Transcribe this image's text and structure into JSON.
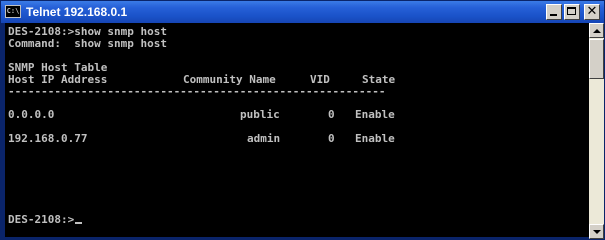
{
  "window": {
    "title": "Telnet 192.168.0.1",
    "icon": "console-icon",
    "icon_text": "C:\\",
    "controls": {
      "minimize": "minimize-icon",
      "maximize": "maximize-icon",
      "close": "close-icon",
      "close_glyph": "✕"
    }
  },
  "console": {
    "prompt_command": "DES-2108:>show snmp host",
    "command_echo": "Command:  show snmp host",
    "table_title": "SNMP Host Table",
    "headers": {
      "ip": "Host IP Address",
      "community": "Community Name",
      "vid": "VID",
      "state": "State"
    },
    "separator": "---------------------------------------------------------",
    "rows": [
      {
        "ip": "0.0.0.0",
        "community": "public",
        "vid": "0",
        "state": "Enable"
      },
      {
        "ip": "192.168.0.77",
        "community": "admin",
        "vid": "0",
        "state": "Enable"
      }
    ],
    "final_prompt": "DES-2108:>"
  },
  "colors": {
    "titlebar": "#1a52c8",
    "console_bg": "#000000",
    "console_text": "#c0c0c0"
  }
}
